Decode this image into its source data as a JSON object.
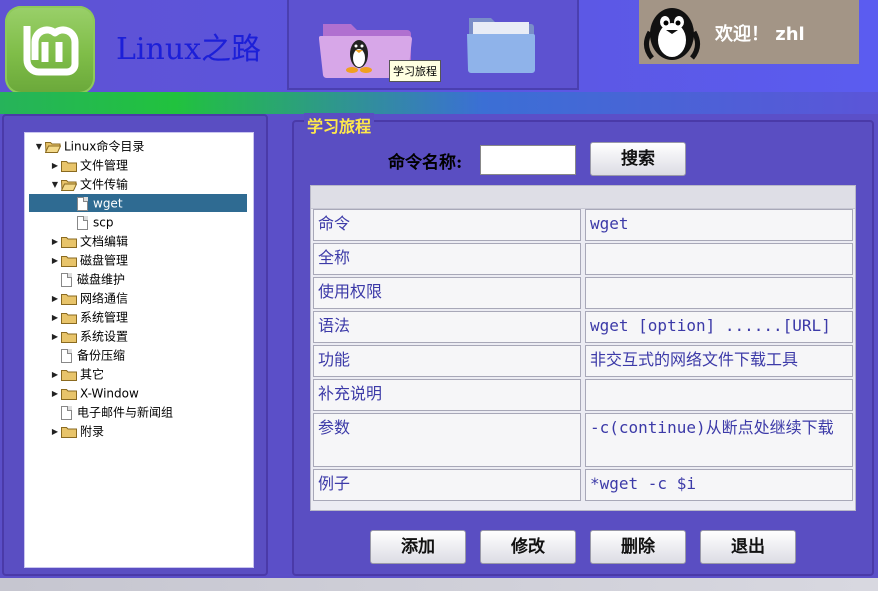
{
  "header": {
    "app_title": "Linux之路",
    "tooltip": "学习旅程",
    "welcome": "欢迎！ zhl",
    "nav": [
      {
        "icon": "study-journey-icon"
      },
      {
        "icon": "folder-icon"
      }
    ]
  },
  "tree": {
    "items": [
      {
        "label": "Linux命令目录",
        "type": "folder",
        "expanded": true,
        "level": 0
      },
      {
        "label": "文件管理",
        "type": "folder",
        "expanded": false,
        "level": 1
      },
      {
        "label": "文件传输",
        "type": "folder",
        "expanded": true,
        "level": 1
      },
      {
        "label": "wget",
        "type": "file",
        "level": 2,
        "selected": true
      },
      {
        "label": "scp",
        "type": "file",
        "level": 2
      },
      {
        "label": "文档编辑",
        "type": "folder",
        "expanded": false,
        "level": 1
      },
      {
        "label": "磁盘管理",
        "type": "folder",
        "expanded": false,
        "level": 1
      },
      {
        "label": "磁盘维护",
        "type": "file",
        "level": 1
      },
      {
        "label": "网络通信",
        "type": "folder",
        "expanded": false,
        "level": 1
      },
      {
        "label": "系统管理",
        "type": "folder",
        "expanded": false,
        "level": 1
      },
      {
        "label": "系统设置",
        "type": "folder",
        "expanded": false,
        "level": 1
      },
      {
        "label": "备份压缩",
        "type": "file",
        "level": 1
      },
      {
        "label": "其它",
        "type": "folder",
        "expanded": false,
        "level": 1
      },
      {
        "label": "X-Window",
        "type": "folder",
        "expanded": false,
        "level": 1
      },
      {
        "label": "电子邮件与新闻组",
        "type": "file",
        "level": 1
      },
      {
        "label": "附录",
        "type": "folder",
        "expanded": false,
        "level": 1
      }
    ]
  },
  "main": {
    "panel_title": "学习旅程",
    "search_label": "命令名称:",
    "search_value": "",
    "search_button": "搜索",
    "rows": [
      {
        "label": "命令",
        "value": "wget"
      },
      {
        "label": "全称",
        "value": ""
      },
      {
        "label": "使用权限",
        "value": ""
      },
      {
        "label": "语法",
        "value": "wget [option] ......[URL]"
      },
      {
        "label": "功能",
        "value": "非交互式的网络文件下载工具"
      },
      {
        "label": "补充说明",
        "value": ""
      },
      {
        "label": "参数",
        "value": "-c(continue)从断点处继续下载"
      },
      {
        "label": "例子",
        "value": "*wget -c $i"
      }
    ],
    "buttons": {
      "add": "添加",
      "edit": "修改",
      "delete": "删除",
      "exit": "退出"
    }
  },
  "colors": {
    "background": "#5b4fc8",
    "title_blue": "#1c1fd8",
    "legend_yellow": "#ffe94a",
    "selected_row": "#2f6b92",
    "cell_text": "#3c3aa8"
  }
}
